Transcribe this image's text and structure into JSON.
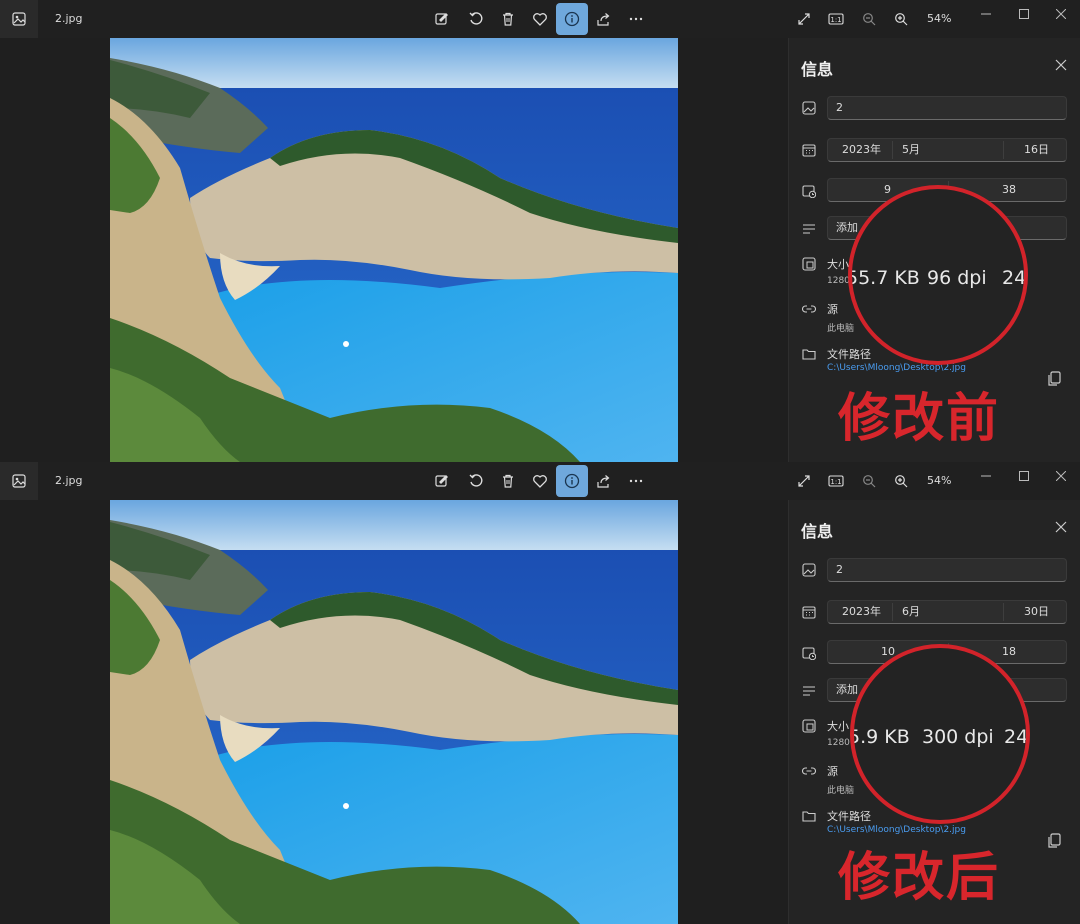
{
  "panes": [
    {
      "file_name": "2.jpg",
      "zoom": "54%",
      "info_title": "信息",
      "title_field": "2",
      "date": {
        "year": "2023年",
        "month": "5月",
        "day": "16日"
      },
      "time": {
        "hour": "9",
        "minute": "38"
      },
      "description_placeholder": "添加",
      "size_label": "大小",
      "dimensions_partial": "1280",
      "source_label": "源",
      "source_value": "此电脑",
      "path_label": "文件路径",
      "path_value": "C:\\Users\\Mloong\\Desktop\\2.jpg",
      "magnified": {
        "file_size": "55.7 KB",
        "dpi": "96 dpi",
        "bit_depth": "24"
      },
      "caption": "修改前"
    },
    {
      "file_name": "2.jpg",
      "zoom": "54%",
      "info_title": "信息",
      "title_field": "2",
      "date": {
        "year": "2023年",
        "month": "6月",
        "day": "30日"
      },
      "time": {
        "hour": "10",
        "minute": "18"
      },
      "description_placeholder": "添加",
      "size_label": "大小",
      "dimensions_partial": "1280",
      "source_label": "源",
      "source_value": "此电脑",
      "path_label": "文件路径",
      "path_value": "C:\\Users\\Mloong\\Desktop\\2.jpg",
      "magnified": {
        "file_size": "5.9 KB",
        "dpi": "300 dpi",
        "bit_depth": "24"
      },
      "caption": "修改后"
    }
  ],
  "icons": {
    "toolbar": [
      "edit-image-icon",
      "rotate-icon",
      "delete-icon",
      "favorite-heart-icon",
      "info-icon",
      "share-icon",
      "more-icon"
    ],
    "view": [
      "fullscreen-icon",
      "actual-size-icon",
      "zoom-out-icon",
      "zoom-in-icon"
    ]
  },
  "colors": {
    "accent": "#6fa8dc",
    "annotation": "#d2232a",
    "link": "#4a9cf0"
  }
}
